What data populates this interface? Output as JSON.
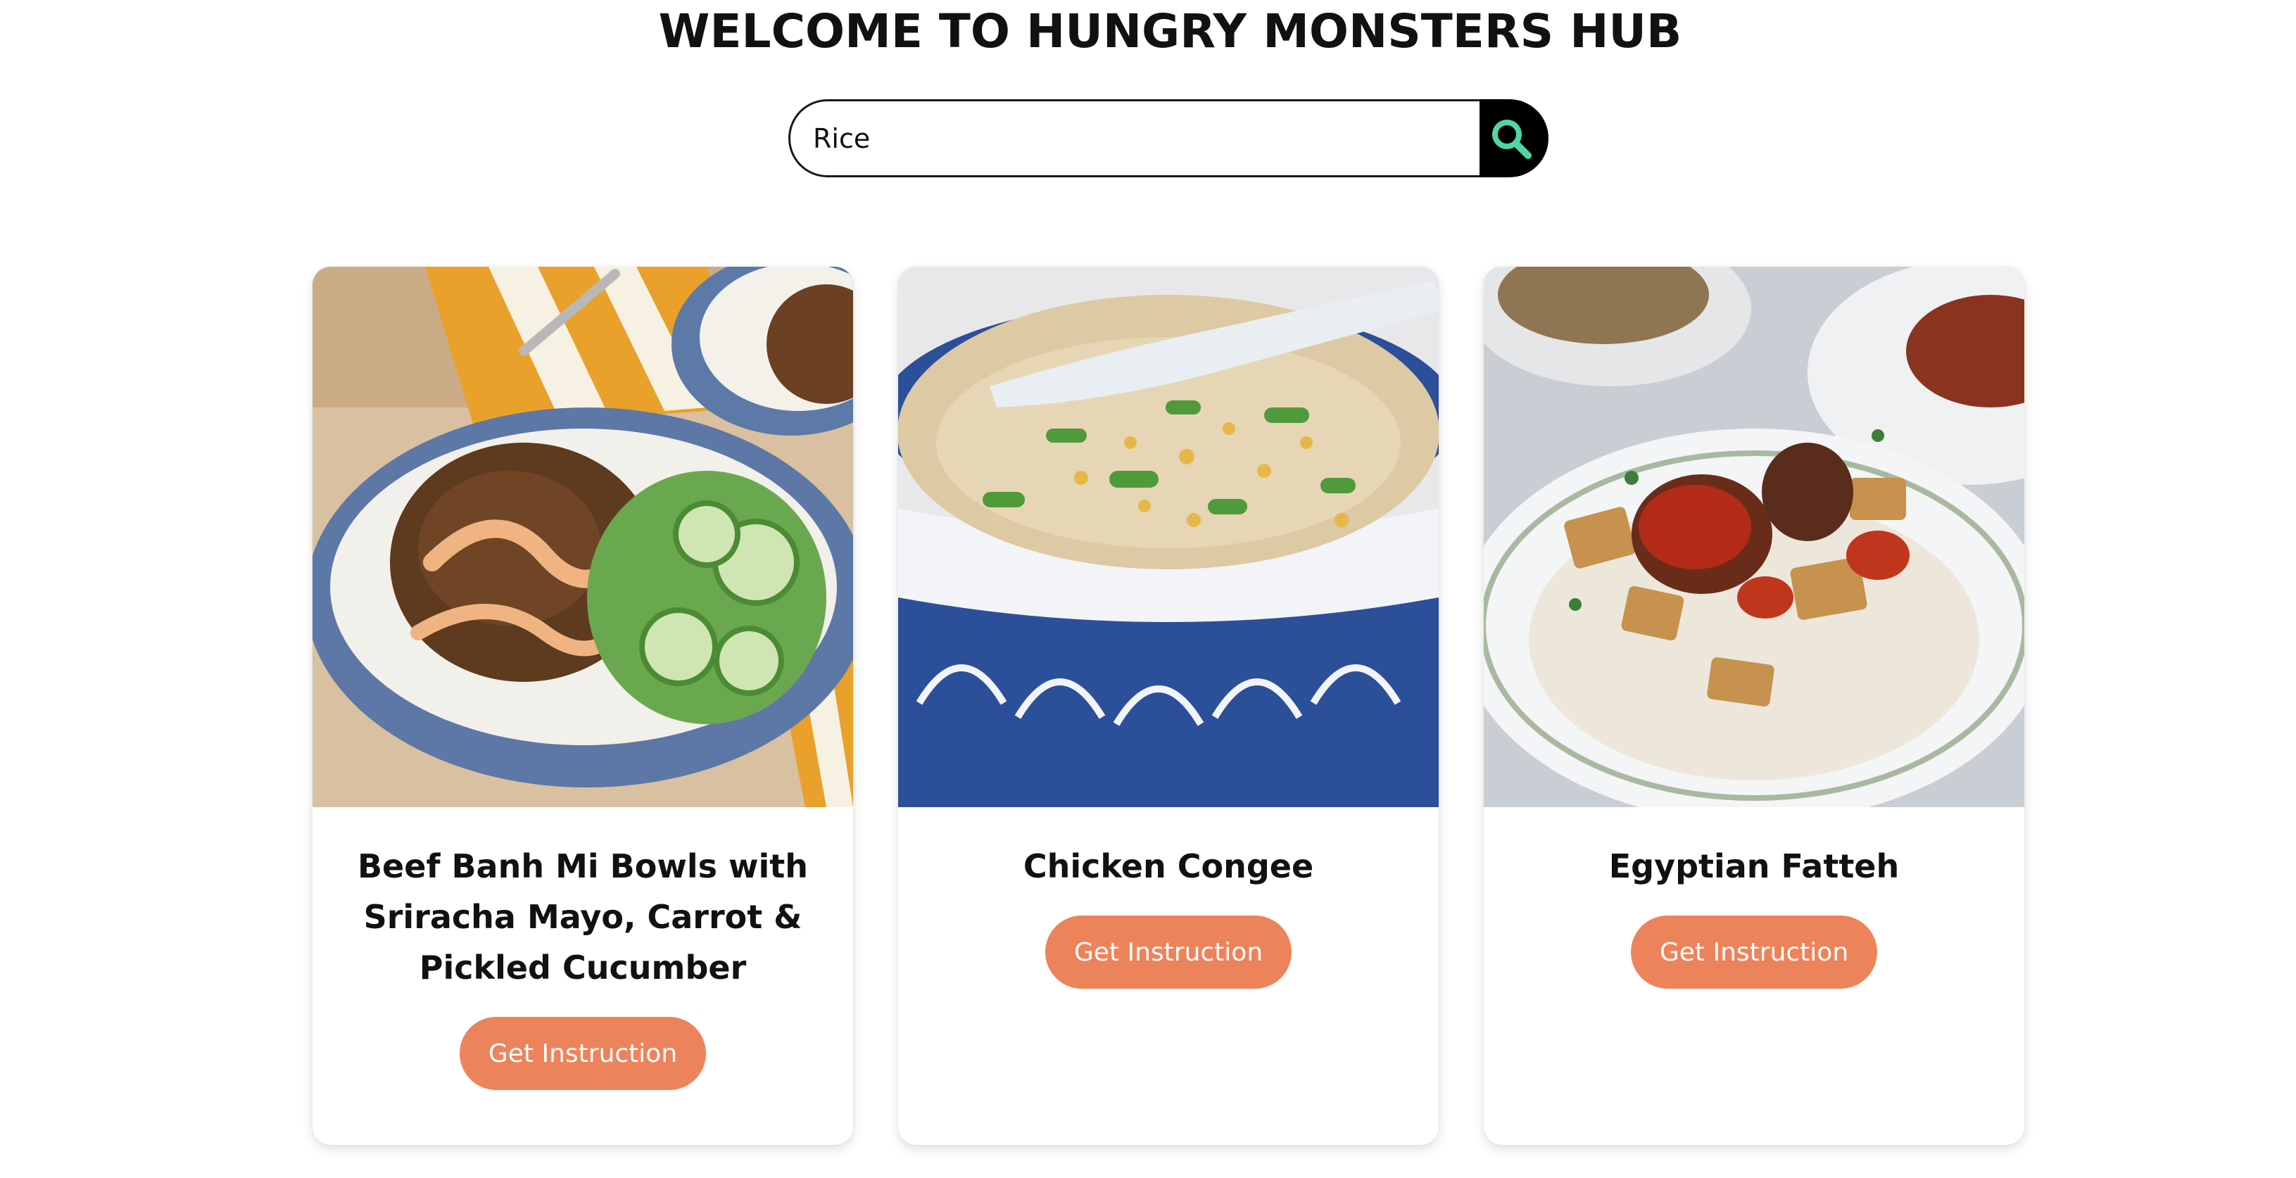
{
  "header": {
    "title": "WELCOME TO HUNGRY MONSTERS HUB"
  },
  "search": {
    "value": "Rice",
    "button_icon": "search-icon"
  },
  "colors": {
    "accent": "#ed835b",
    "search_button": "#000000",
    "search_icon": "#4fd6a3"
  },
  "meals": [
    {
      "name": "Beef Banh Mi Bowls with Sriracha Mayo, Carrot & Pickled Cucumber",
      "button_label": "Get Instruction"
    },
    {
      "name": "Chicken Congee",
      "button_label": "Get Instruction"
    },
    {
      "name": "Egyptian Fatteh",
      "button_label": "Get Instruction"
    }
  ]
}
